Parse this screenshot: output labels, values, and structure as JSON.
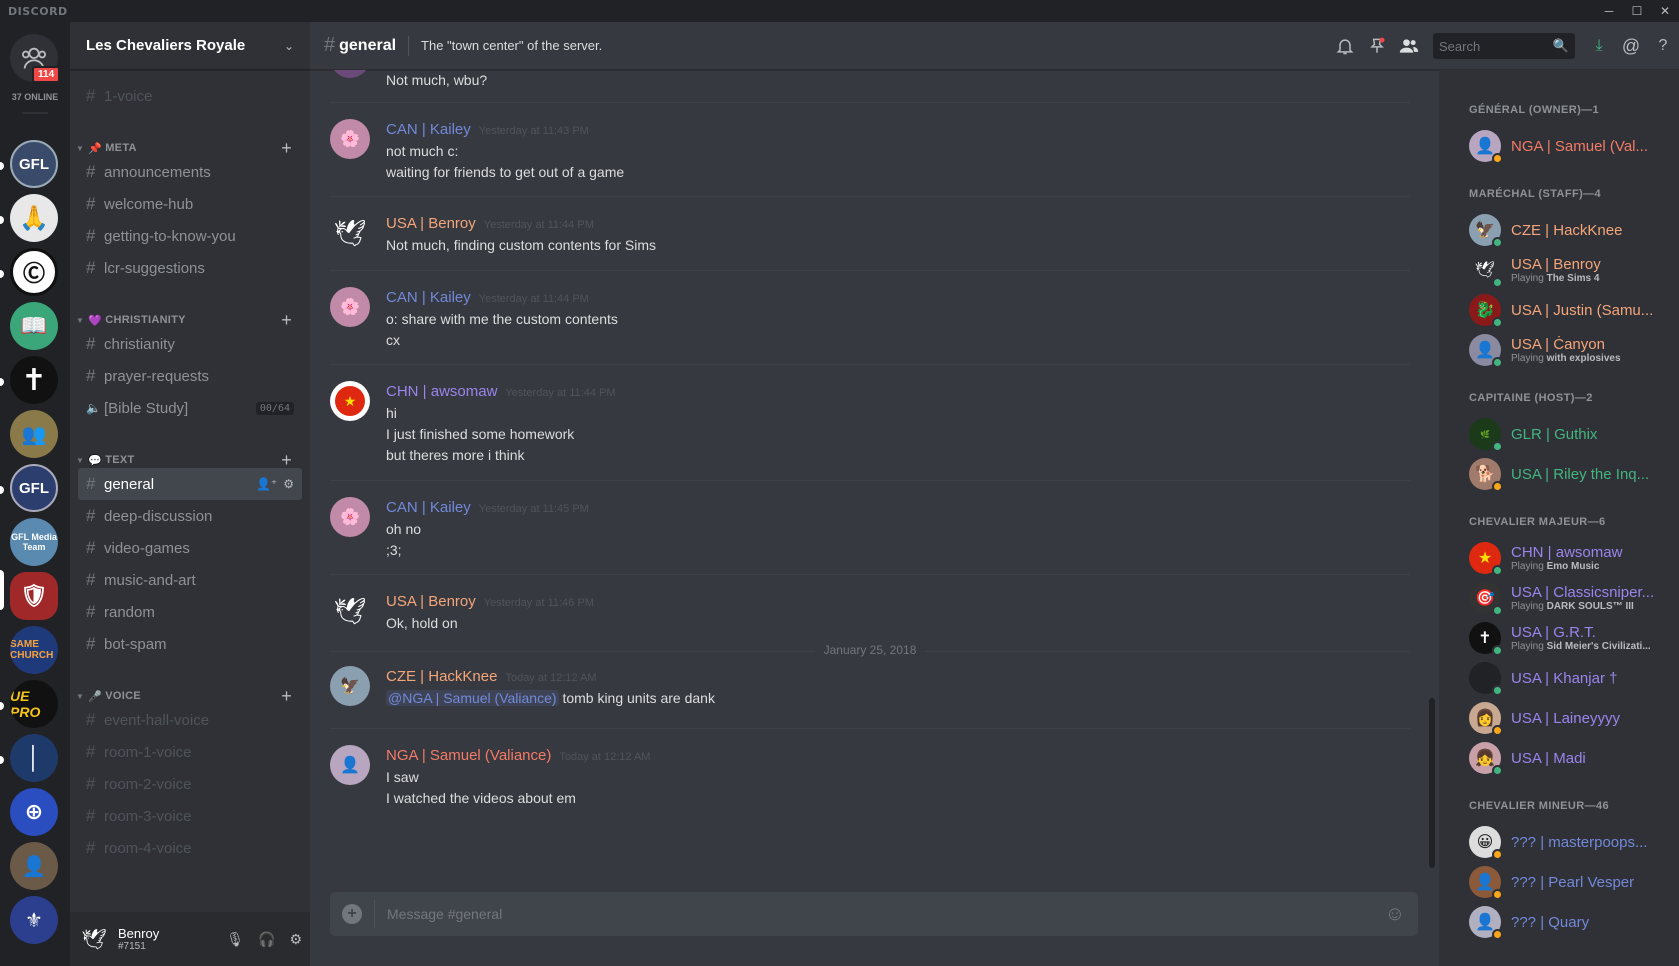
{
  "app": {
    "title": "DISCORD"
  },
  "colors": {
    "accent": "#7289da",
    "online": "#43b581",
    "idle": "#faa61a",
    "red": "#f04747",
    "owner": "#f47b67",
    "staff": "#f4a57a",
    "host": "#43b581",
    "major": "#9b84ec",
    "minor": "#7289da"
  },
  "guilds": {
    "notification_count": "114",
    "online_text": "37 ONLINE",
    "items": [
      "GFL",
      "hands",
      "CT",
      "book",
      "cross",
      "group",
      "GFL",
      "GFL Media Team",
      "shield",
      "SAME CHURCH",
      "UE PRO",
      "lighthouse",
      "cross-flag",
      "person",
      "seal"
    ]
  },
  "server": {
    "name": "Les Chevaliers Royale"
  },
  "channels": {
    "top": {
      "name": "1-voice"
    },
    "categories": [
      {
        "name": "META",
        "emoji": "📌"
      },
      {
        "name": "CHRISTIANITY",
        "emoji": "💜"
      },
      {
        "name": "TEXT",
        "emoji": "💬"
      },
      {
        "name": "VOICE",
        "emoji": "🎤"
      }
    ],
    "meta": [
      "announcements",
      "welcome-hub",
      "getting-to-know-you",
      "lcr-suggestions"
    ],
    "christianity": [
      "christianity",
      "prayer-requests"
    ],
    "voice_channel": {
      "name": "[Bible Study]",
      "count": "00/64"
    },
    "text": [
      "general",
      "deep-discussion",
      "video-games",
      "music-and-art",
      "random",
      "bot-spam"
    ],
    "voice": [
      "event-hall-voice",
      "room-1-voice",
      "room-2-voice",
      "room-3-voice",
      "room-4-voice"
    ]
  },
  "user": {
    "name": "Benroy",
    "discriminator": "#7151"
  },
  "chat": {
    "channel": "general",
    "topic": "The \"town center\" of the server.",
    "search_placeholder": "Search",
    "composer_placeholder": "Message #general"
  },
  "messages": [
    {
      "author": "",
      "time": "",
      "lines": [
        "Not much, wbu?"
      ]
    },
    {
      "author": "CAN | Kailey",
      "time": "Yesterday at 11:43 PM",
      "lines": [
        "not much c:",
        "waiting for friends to get out of a game"
      ]
    },
    {
      "author": "USA | Benroy",
      "time": "Yesterday at 11:44 PM",
      "lines": [
        "Not much, finding custom contents for Sims"
      ]
    },
    {
      "author": "CAN | Kailey",
      "time": "Yesterday at 11:44 PM",
      "lines": [
        "o: share with me the custom contents",
        "cx"
      ]
    },
    {
      "author": "CHN | awsomaw",
      "time": "Yesterday at 11:44 PM",
      "lines": [
        "hi",
        "I just finished some homework",
        "but theres more i think"
      ]
    },
    {
      "author": "CAN | Kailey",
      "time": "Yesterday at 11:45 PM",
      "lines": [
        "oh no",
        ";3;"
      ]
    },
    {
      "author": "USA | Benroy",
      "time": "Yesterday at 11:46 PM",
      "lines": [
        "Ok, hold on"
      ]
    },
    {
      "author": "CZE | HackKnee",
      "time": "Today at 12:12 AM",
      "mention": "@NGA | Samuel (Valiance)",
      "lines": [
        "tomb king units are dank"
      ]
    },
    {
      "author": "NGA | Samuel (Valiance)",
      "time": "Today at 12:12 AM",
      "lines": [
        "I saw",
        "I watched the videos about em"
      ]
    }
  ],
  "date_divider": "January 25, 2018",
  "members": {
    "groups": [
      {
        "label": "GÉNÉRAL (OWNER)—1"
      },
      {
        "label": "MARÉCHAL (STAFF)—4"
      },
      {
        "label": "CAPITAINE (HOST)—2"
      },
      {
        "label": "CHEVALIER MAJEUR—6"
      },
      {
        "label": "CHEVALIER MINEUR—46"
      }
    ],
    "list": [
      {
        "name": "NGA | Samuel (Val...",
        "activity": "",
        "game": ""
      },
      {
        "name": "CZE | HackKnee",
        "activity": "",
        "game": ""
      },
      {
        "name": "USA | Benroy",
        "activity": "Playing",
        "game": "The Sims 4"
      },
      {
        "name": "USA | Justin (Samu...",
        "activity": "",
        "game": ""
      },
      {
        "name": "USA | Ċanyon",
        "activity": "Playing",
        "game": "with explosives"
      },
      {
        "name": "GLR | Guthix",
        "activity": "",
        "game": ""
      },
      {
        "name": "USA | Riley the Inq...",
        "activity": "",
        "game": ""
      },
      {
        "name": "CHN | awsomaw",
        "activity": "Playing",
        "game": "Emo Music"
      },
      {
        "name": "USA | Classicsniper...",
        "activity": "Playing",
        "game": "DARK SOULS™ III"
      },
      {
        "name": "USA | G.R.T.",
        "activity": "Playing",
        "game": "Sid Meier's Civilizati..."
      },
      {
        "name": "USA | Khanjar †",
        "activity": "",
        "game": ""
      },
      {
        "name": "USA | Laineyyyy",
        "activity": "",
        "game": ""
      },
      {
        "name": "USA | Madi",
        "activity": "",
        "game": ""
      },
      {
        "name": "??? | masterpoops...",
        "activity": "",
        "game": ""
      },
      {
        "name": "??? | Pearl Vesper",
        "activity": "",
        "game": ""
      },
      {
        "name": "??? | Quary",
        "activity": "",
        "game": ""
      }
    ]
  }
}
